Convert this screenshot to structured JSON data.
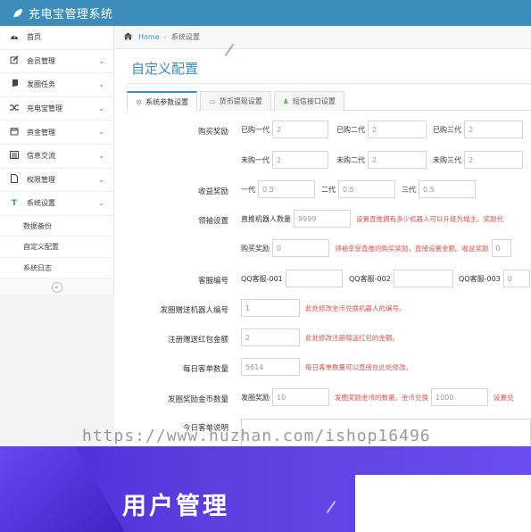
{
  "header": {
    "app_title": "充电宝管理系统"
  },
  "sidebar": {
    "items": [
      {
        "icon": "dashboard-icon",
        "label": "首页",
        "has_chevron": false
      },
      {
        "icon": "edit-icon",
        "label": "会员管理",
        "has_chevron": true
      },
      {
        "icon": "book-icon",
        "label": "发圈任务",
        "has_chevron": true
      },
      {
        "icon": "shuffle-icon",
        "label": "充电宝管理",
        "has_chevron": true
      },
      {
        "icon": "calendar-icon",
        "label": "资金管理",
        "has_chevron": true
      },
      {
        "icon": "list-icon",
        "label": "信息交流",
        "has_chevron": true
      },
      {
        "icon": "file-icon",
        "label": "权限管理",
        "has_chevron": true
      },
      {
        "icon": "text-icon",
        "label": "系统设置",
        "has_chevron": true
      }
    ],
    "sub_items": [
      {
        "label": "数据备份"
      },
      {
        "label": "自定义配置"
      },
      {
        "label": "系统日志"
      }
    ]
  },
  "breadcrumb": {
    "home": "Home",
    "current": "系统设置"
  },
  "main": {
    "title": "自定义配置",
    "tabs": [
      {
        "label": "系统参数设置",
        "icon": "gears-icon",
        "active": true
      },
      {
        "label": "货币提现设置",
        "icon": "card-icon",
        "active": false
      },
      {
        "label": "短信接口设置",
        "icon": "user-icon",
        "active": false
      }
    ]
  },
  "form": {
    "purchase_reward": {
      "label": "购买奖励",
      "row1": [
        {
          "label": "已购一代",
          "value": "2"
        },
        {
          "label": "已购二代",
          "value": "2"
        },
        {
          "label": "已购三代",
          "value": "2"
        }
      ],
      "row2": [
        {
          "label": "未购一代",
          "value": "2"
        },
        {
          "label": "未购二代",
          "value": "2"
        },
        {
          "label": "未购三代",
          "value": "2"
        }
      ]
    },
    "income_reward": {
      "label": "收益奖励",
      "fields": [
        {
          "label": "一代",
          "value": "0.5"
        },
        {
          "label": "二代",
          "value": "0.5"
        },
        {
          "label": "三代",
          "value": "0.5"
        }
      ]
    },
    "leader_setting": {
      "label": "领袖设置",
      "robot_count_label": "直推机器人数量",
      "robot_count_value": "9999",
      "robot_hint": "设置直推拥有多少机器人可以升级为城主。奖励代",
      "buy_reward_label": "购买奖励",
      "buy_reward_value": "0",
      "buy_reward_hint": "领袖享受直推的购买奖励，直接设置金额。收益奖励",
      "income_value": "0"
    },
    "customer_service": {
      "label": "客服编号",
      "fields": [
        {
          "label": "QQ客服-001",
          "value": ""
        },
        {
          "label": "QQ客服-002",
          "value": ""
        },
        {
          "label": "QQ客服-003",
          "value": "0"
        }
      ]
    },
    "gift_robot": {
      "label": "发圈赠送机器人编号",
      "value": "1",
      "hint": "此处修改金币兑换机器人的编号。"
    },
    "register_gift": {
      "label": "注册赠送红包金额",
      "value": "2",
      "hint": "此处修改注册赠送红包的金额。"
    },
    "daily_orders": {
      "label": "每日客单数量",
      "value": "5614",
      "hint": "每日客单数量可以直接在此处修改。"
    },
    "circle_reward": {
      "label": "发圈奖励金币数量",
      "reward_label": "发圈奖励",
      "reward_value": "10",
      "hint": "发圈奖励金币的数量。金币兑换",
      "exchange_value": "1000",
      "hint2": "设置兑"
    },
    "daily_desc": {
      "label": "今日客单说明"
    }
  },
  "watermark": "https://www.huzhan.com/ishop16496",
  "banner": {
    "text": "用户管理"
  }
}
